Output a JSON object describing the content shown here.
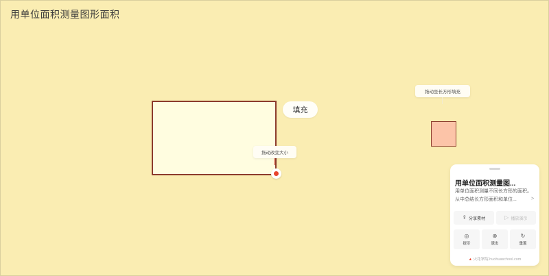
{
  "page_title": "用单位面积测量图形面积",
  "canvas": {
    "fill_button": "填充",
    "tip_resize": "拖动改变大小",
    "tip_unit": "拖动至长方形填充"
  },
  "panel": {
    "title": "用单位面积测量图...",
    "description": "用单位面积测量不同长方形的面积。从中总结长方形面积和单位...",
    "share_label": "分享素材",
    "play_label": "播放演示",
    "hint_label": "提示",
    "exit_label": "退出",
    "reset_label": "重置",
    "footer_brand": "火花学院",
    "footer_url": "huohuaschool.com"
  },
  "colors": {
    "background": "#faedb2",
    "main_rect_fill": "#fffde0",
    "main_rect_border": "#8c3b2c",
    "unit_square_fill": "#fcc4a8",
    "handle_accent": "#e8452f"
  }
}
